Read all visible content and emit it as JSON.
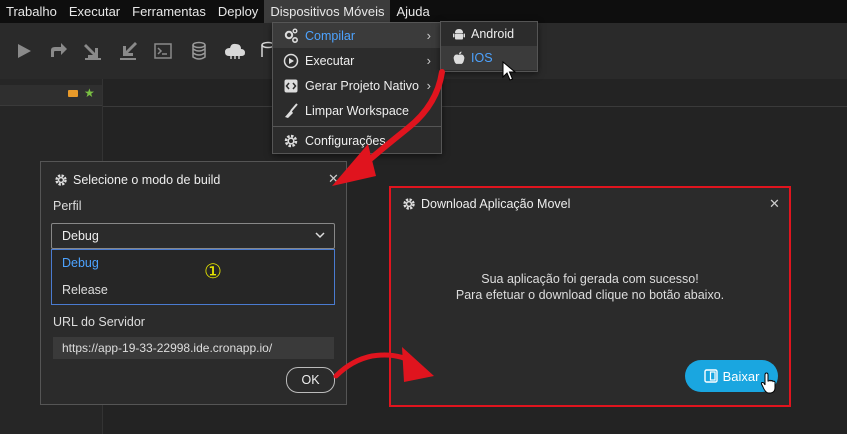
{
  "menubar": {
    "items": [
      "Trabalho",
      "Executar",
      "Ferramentas",
      "Deploy",
      "Dispositivos Móveis",
      "Ajuda"
    ]
  },
  "menu_dispositivos": {
    "items": [
      {
        "label": "Compilar",
        "icon": "gears-icon"
      },
      {
        "label": "Executar",
        "icon": "play-circle-icon"
      },
      {
        "label": "Gerar Projeto Nativo",
        "icon": "code-icon"
      },
      {
        "label": "Limpar Workspace",
        "icon": "broom-icon"
      },
      {
        "label": "Configurações",
        "icon": "gear-icon"
      }
    ]
  },
  "submenu_compilar": {
    "items": [
      {
        "label": "Android",
        "icon": "android-icon"
      },
      {
        "label": "IOS",
        "icon": "apple-icon"
      }
    ]
  },
  "build_dialog": {
    "title": "Selecione o modo de build",
    "perfil_label": "Perfil",
    "selected": "Debug",
    "options": [
      "Debug",
      "Release"
    ],
    "url_label": "URL do Servidor",
    "url_value": "https://app-19-33-22998.ide.cronapp.io/",
    "ok_label": "OK",
    "step_marker": "①"
  },
  "download_dialog": {
    "title": "Download Aplicação Movel",
    "message_line1": "Sua aplicação foi gerada com sucesso!",
    "message_line2": "Para efetuar o download clique no botão abaixo.",
    "button_label": "Baixar"
  },
  "colors": {
    "accent_blue": "#4da3ff",
    "annotation_red": "#e0141e",
    "button_cyan": "#1aa6e0",
    "step_marker": "#e6e600"
  }
}
